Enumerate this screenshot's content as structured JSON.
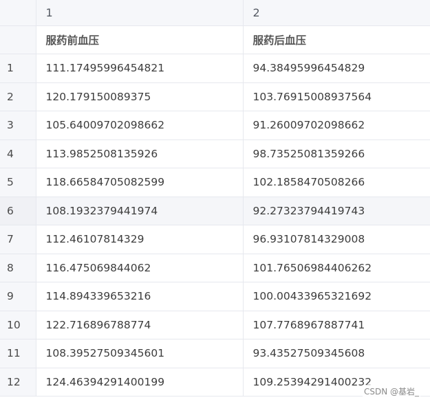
{
  "columns": [
    "1",
    "2"
  ],
  "names": [
    "服药前血压",
    "服药后血压"
  ],
  "rows": [
    {
      "index": "1",
      "a": "111.17495996454821",
      "b": "94.38495996454829"
    },
    {
      "index": "2",
      "a": "120.179150089375",
      "b": "103.76915008937564"
    },
    {
      "index": "3",
      "a": "105.64009702098662",
      "b": "91.26009702098662"
    },
    {
      "index": "4",
      "a": "113.9852508135926",
      "b": "98.73525081359266"
    },
    {
      "index": "5",
      "a": "118.66584705082599",
      "b": "102.1858470508266"
    },
    {
      "index": "6",
      "a": "108.1932379441974",
      "b": "92.27323794419743"
    },
    {
      "index": "7",
      "a": "112.46107814329",
      "b": "96.93107814329008"
    },
    {
      "index": "8",
      "a": "116.475069844062",
      "b": "101.76506984406262"
    },
    {
      "index": "9",
      "a": "114.894339653216",
      "b": "100.00433965321692"
    },
    {
      "index": "10",
      "a": "122.716896788774",
      "b": "107.7768967887741"
    },
    {
      "index": "11",
      "a": "108.39527509345601",
      "b": "93.43527509345608"
    },
    {
      "index": "12",
      "a": "124.46394291400199",
      "b": "109.25394291400232"
    }
  ],
  "watermark": "CSDN @基岩_"
}
